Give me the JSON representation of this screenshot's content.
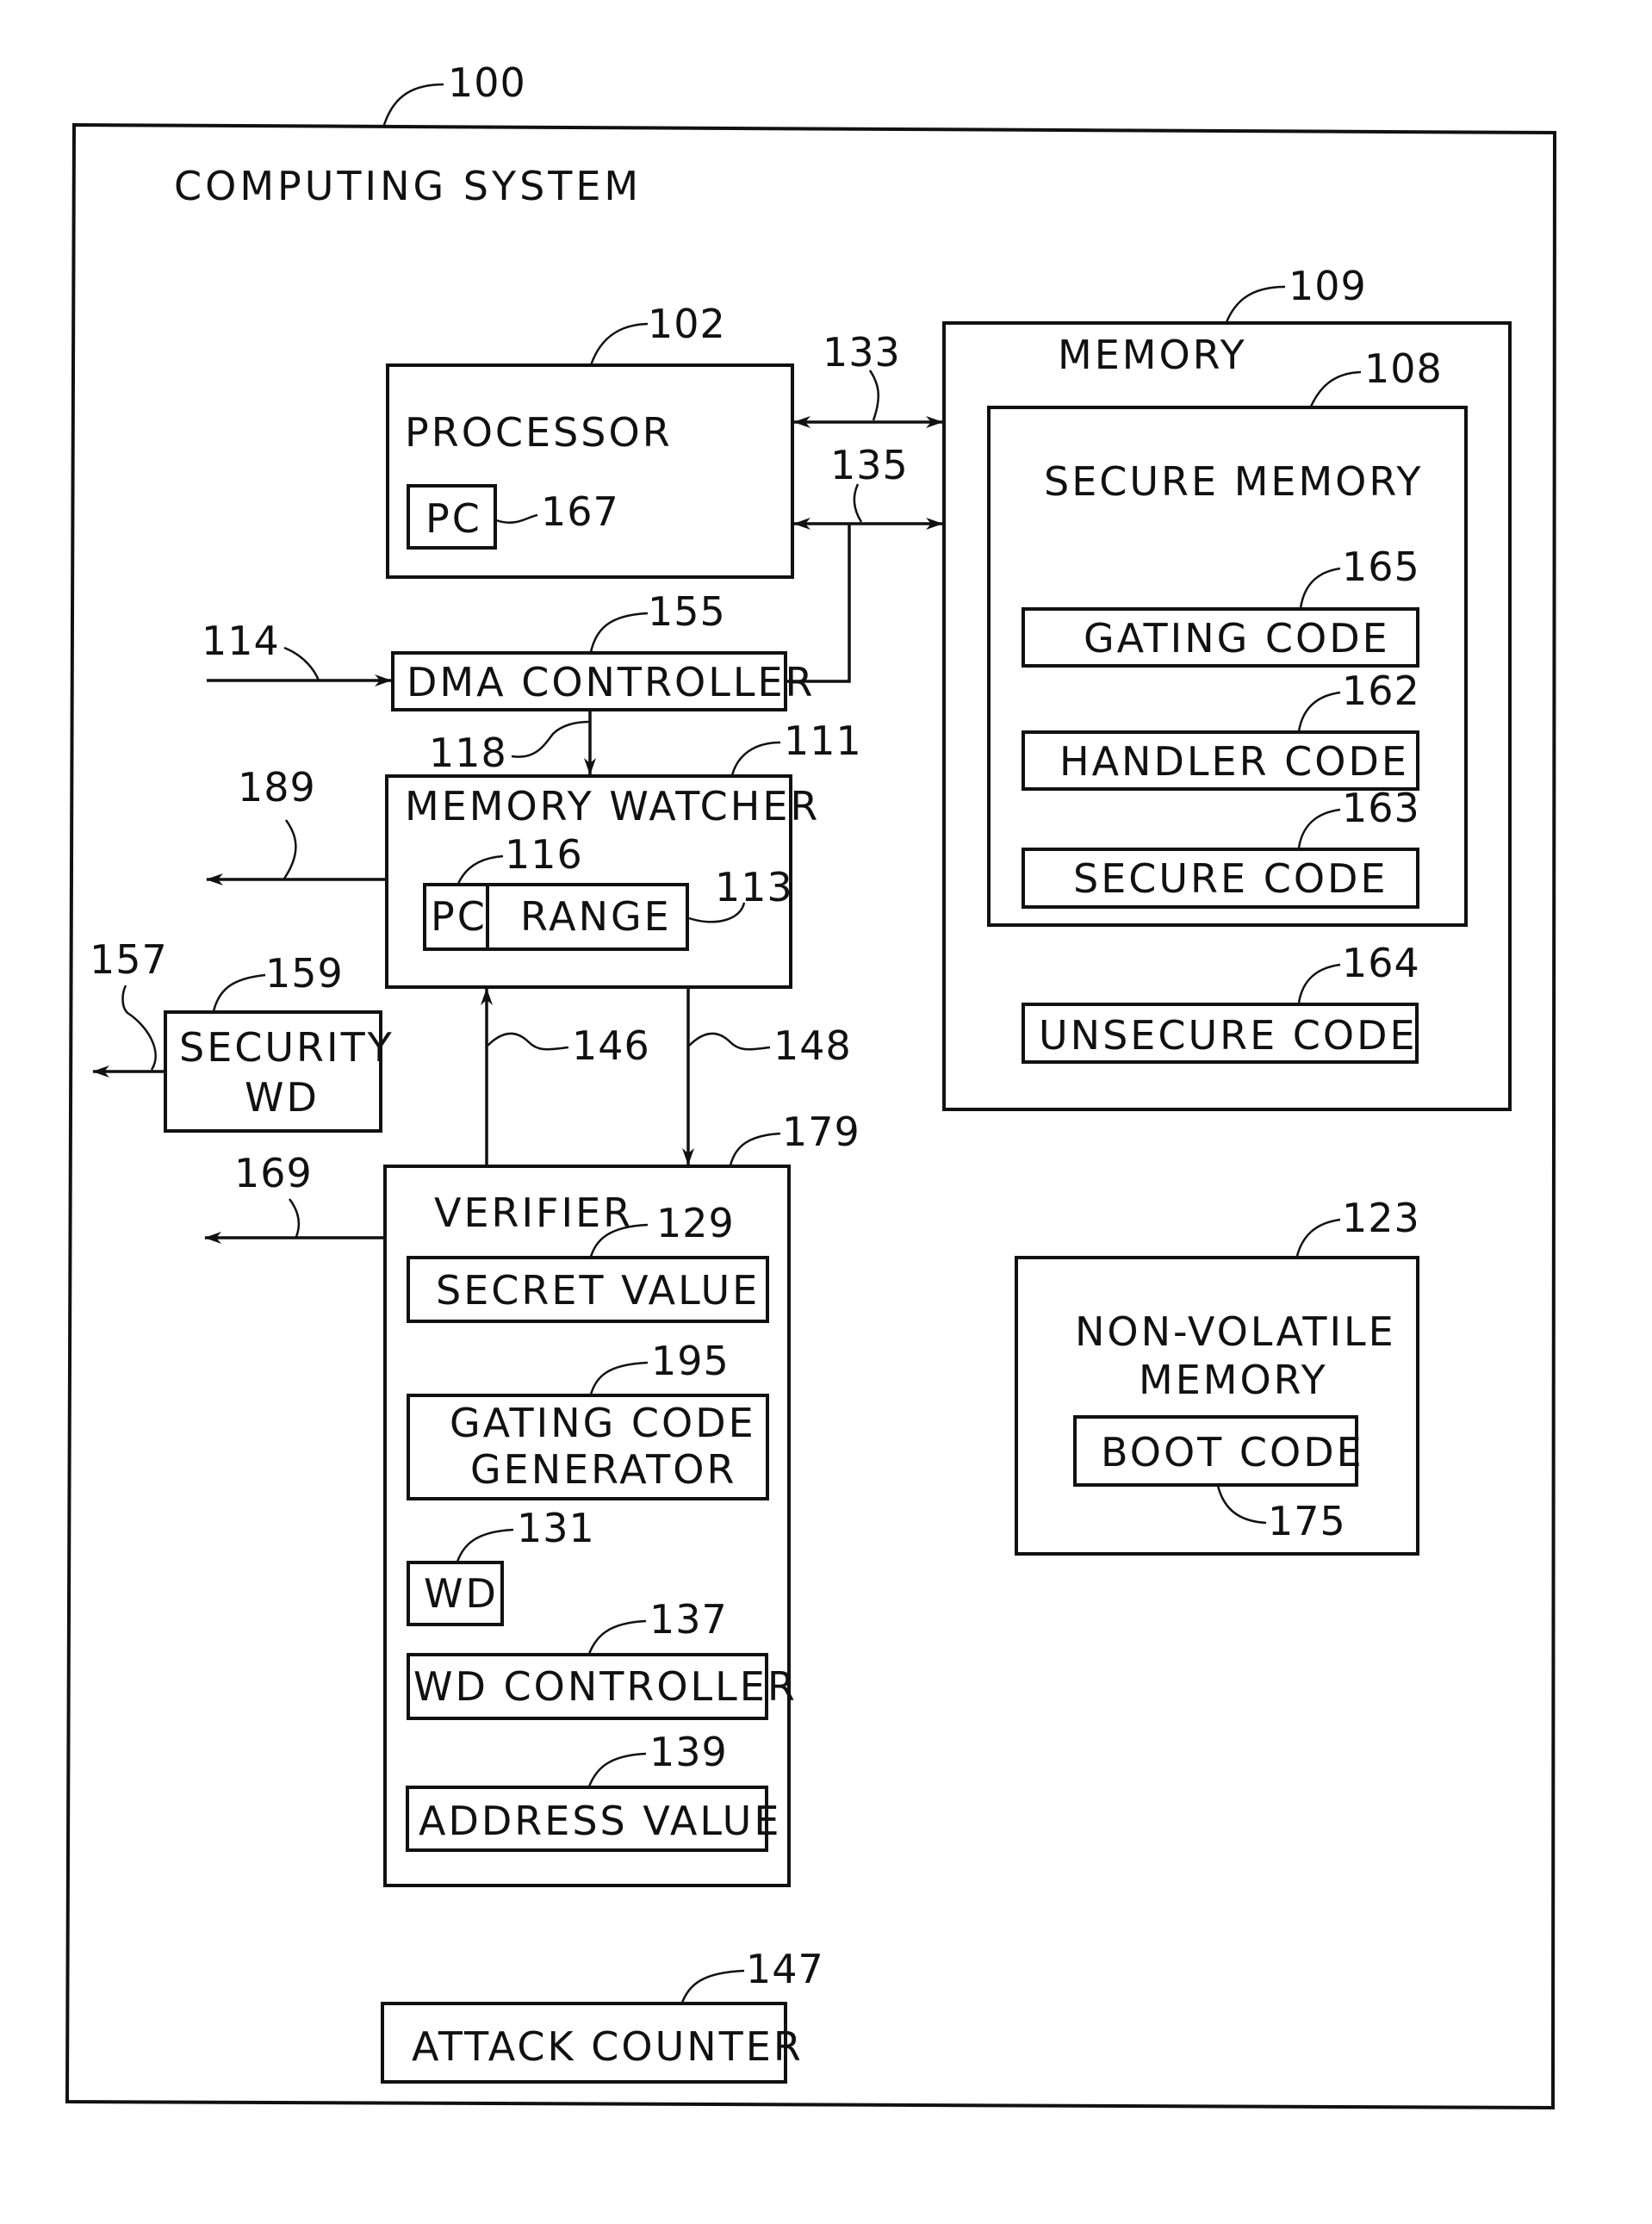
{
  "figure": {
    "system_ref": "100",
    "system_title": "COMPUTING SYSTEM"
  },
  "blocks": {
    "processor": {
      "label": "PROCESSOR",
      "ref": "102"
    },
    "processor_pc": {
      "label": "PC",
      "ref": "167"
    },
    "memory": {
      "label": "MEMORY",
      "ref": "109"
    },
    "secure_memory": {
      "label": "SECURE MEMORY",
      "ref": "108"
    },
    "gating_code": {
      "label": "GATING CODE",
      "ref": "165"
    },
    "handler_code": {
      "label": "HANDLER CODE",
      "ref": "162"
    },
    "secure_code": {
      "label": "SECURE CODE",
      "ref": "163"
    },
    "unsecure_code": {
      "label": "UNSECURE CODE",
      "ref": "164"
    },
    "dma_controller": {
      "label": "DMA CONTROLLER",
      "ref": "155"
    },
    "memory_watcher": {
      "label": "MEMORY WATCHER",
      "ref": "111"
    },
    "watcher_pc": {
      "label": "PC",
      "ref": "116"
    },
    "watcher_range": {
      "label": "RANGE",
      "ref": "113"
    },
    "security_wd": {
      "label_line1": "SECURITY",
      "label_line2": "WD",
      "ref": "159"
    },
    "verifier": {
      "label": "VERIFIER",
      "ref": "179"
    },
    "secret_value": {
      "label": "SECRET VALUE",
      "ref": "129"
    },
    "gating_code_generator": {
      "label_line1": "GATING CODE",
      "label_line2": "GENERATOR",
      "ref": "195"
    },
    "wd": {
      "label": "WD",
      "ref": "131"
    },
    "wd_controller": {
      "label": "WD CONTROLLER",
      "ref": "137"
    },
    "address_value": {
      "label": "ADDRESS VALUE",
      "ref": "139"
    },
    "non_volatile_memory": {
      "label_line1": "NON-VOLATILE",
      "label_line2": "MEMORY",
      "ref": "123"
    },
    "boot_code": {
      "label": "BOOT CODE",
      "ref": "175"
    },
    "attack_counter": {
      "label": "ATTACK COUNTER",
      "ref": "147"
    }
  },
  "signals": {
    "bus_133": "133",
    "bus_135": "135",
    "dma_input": "114",
    "dma_to_watcher": "118",
    "watcher_output": "189",
    "security_wd_output": "157",
    "verifier_to_watcher": "146",
    "watcher_to_verifier": "148",
    "verifier_output": "169"
  }
}
